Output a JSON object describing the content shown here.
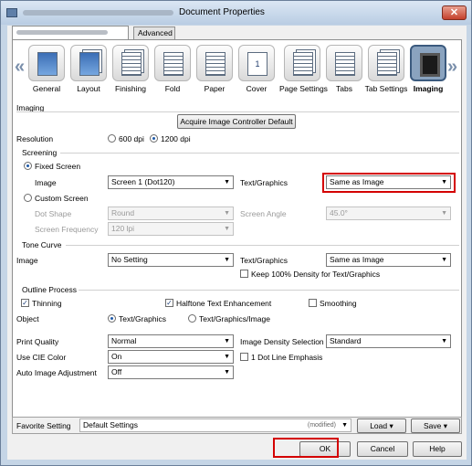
{
  "window": {
    "title": "Document Properties",
    "close_symbol": "✕"
  },
  "tabs": [
    {
      "label": ""
    },
    {
      "label": "Advanced"
    }
  ],
  "nav": {
    "left": "«",
    "right": "»"
  },
  "categories": [
    {
      "label": "General",
      "icon": "general-icon"
    },
    {
      "label": "Layout",
      "icon": "layout-icon"
    },
    {
      "label": "Finishing",
      "icon": "finishing-icon"
    },
    {
      "label": "Fold",
      "icon": "fold-icon"
    },
    {
      "label": "Paper",
      "icon": "paper-icon"
    },
    {
      "label": "Cover",
      "icon": "cover-icon",
      "glyph": "1"
    },
    {
      "label": "Page Settings",
      "icon": "page-settings-icon"
    },
    {
      "label": "Tabs",
      "icon": "tabs-icon"
    },
    {
      "label": "Tab Settings",
      "icon": "tab-settings-icon"
    },
    {
      "label": "Imaging",
      "icon": "imaging-icon",
      "selected": true
    }
  ],
  "imaging": {
    "section_label": "Imaging",
    "acquire_button": "Acquire Image Controller Default",
    "resolution": {
      "label": "Resolution",
      "option1": "600 dpi",
      "option2": "1200 dpi",
      "selected": "1200 dpi"
    },
    "screening": {
      "label": "Screening",
      "fixed_label": "Fixed Screen",
      "image_label": "Image",
      "image_value": "Screen 1 (Dot120)",
      "text_graphics_label": "Text/Graphics",
      "text_graphics_value": "Same as Image",
      "custom_label": "Custom Screen",
      "dot_shape_label": "Dot Shape",
      "dot_shape_value": "Round",
      "screen_angle_label": "Screen Angle",
      "screen_angle_value": "45.0°",
      "screen_freq_label": "Screen Frequency",
      "screen_freq_value": "120 lpi"
    },
    "tone_curve": {
      "label": "Tone Curve",
      "image_label": "Image",
      "image_value": "No Setting",
      "text_graphics_label": "Text/Graphics",
      "text_graphics_value": "Same as Image",
      "keep_density_label": "Keep 100% Density for Text/Graphics"
    },
    "outline": {
      "label": "Outline Process",
      "thinning_label": "Thinning",
      "halftone_label": "Halftone Text Enhancement",
      "smoothing_label": "Smoothing",
      "object_label": "Object",
      "object_opt1": "Text/Graphics",
      "object_opt2": "Text/Graphics/Image"
    },
    "print_quality": {
      "label": "Print Quality",
      "value": "Normal"
    },
    "image_density": {
      "label": "Image Density Selection",
      "value": "Standard"
    },
    "cie": {
      "label": "Use CIE Color",
      "value": "On"
    },
    "dot_line": {
      "label": "1 Dot Line Emphasis"
    },
    "auto_adjust": {
      "label": "Auto Image Adjustment",
      "value": "Off"
    }
  },
  "favorite": {
    "label": "Favorite Setting",
    "value": "Default Settings",
    "modified": "(modified)",
    "load": "Load",
    "save": "Save"
  },
  "buttons": {
    "ok": "OK",
    "cancel": "Cancel",
    "help": "Help"
  },
  "colors": {
    "highlight": "#d40000",
    "selected_icon": "#8aa3bf"
  }
}
